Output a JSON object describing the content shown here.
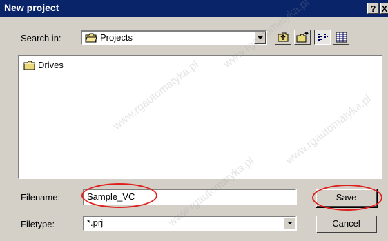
{
  "window": {
    "title": "New project",
    "help_glyph": "?",
    "close_glyph": "X"
  },
  "search": {
    "label": "Search in:",
    "value": "Projects"
  },
  "toolbar": {
    "icons": [
      "up-folder-icon",
      "new-folder-icon",
      "list-view-icon",
      "details-view-icon"
    ]
  },
  "list": {
    "items": [
      {
        "label": "Drives",
        "icon": "folder-icon"
      }
    ]
  },
  "filename": {
    "label": "Filename:",
    "value": "Sample_VC"
  },
  "filetype": {
    "label": "Filetype:",
    "value": "*.prj"
  },
  "buttons": {
    "save": "Save",
    "cancel": "Cancel"
  },
  "watermark": "www.rgautomatyka.pl",
  "colors": {
    "titlebar": "#0a246a",
    "dialog_bg": "#d4d0c8",
    "highlight_ellipse": "#e0201c"
  }
}
